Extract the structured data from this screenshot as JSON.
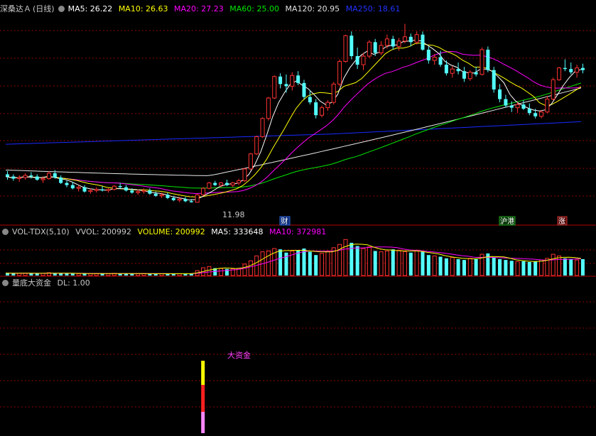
{
  "main_header": {
    "stock_name": "深桑达Ａ",
    "period": "(日线)",
    "ma5": "MA5: 26.22",
    "ma10": "MA10: 26.63",
    "ma20": "MA20: 27.23",
    "ma60": "MA60: 25.00",
    "ma120": "MA120: 20.95",
    "ma250": "MA250: 18.61"
  },
  "vol_header": {
    "name": "VOL-TDX(5,10)",
    "vvol": "VVOL: 200992",
    "volume": "VOLUME: 200992",
    "ma5": "MA5: 333648",
    "ma10": "MA10: 372981"
  },
  "ind_header": {
    "name": "量底大资金",
    "dl": "DL: 1.00"
  },
  "annotations": {
    "low_price": "11.98",
    "badge_cai": "财",
    "badge_hugang": "沪港",
    "badge_zhang": "涨",
    "signal_label": "大资金"
  },
  "colors": {
    "up": "#ff3232",
    "down": "#54ffff",
    "ma5": "#ffffff",
    "ma10": "#ffff00",
    "ma20": "#ff00ff",
    "ma60": "#00e600",
    "ma120": "#e8e8e8",
    "ma250": "#1a2aff",
    "grid": "#8a0000"
  },
  "chart_data": [
    {
      "type": "candlestick",
      "title": "深桑达Ａ (日线)",
      "series": [
        {
          "name": "MA5",
          "last": 26.22
        },
        {
          "name": "MA10",
          "last": 26.63
        },
        {
          "name": "MA20",
          "last": 27.23
        },
        {
          "name": "MA60",
          "last": 25.0
        },
        {
          "name": "MA120",
          "last": 20.95
        },
        {
          "name": "MA250",
          "last": 18.61
        }
      ],
      "low_label": 11.98,
      "ohlc": [
        [
          14.6,
          14.9,
          14.1,
          14.4
        ],
        [
          14.4,
          14.6,
          14.0,
          14.2
        ],
        [
          14.2,
          14.5,
          13.9,
          14.3
        ],
        [
          14.3,
          14.7,
          14.1,
          14.5
        ],
        [
          14.5,
          14.8,
          14.2,
          14.4
        ],
        [
          14.4,
          14.6,
          14.0,
          14.1
        ],
        [
          14.1,
          14.4,
          13.8,
          14.2
        ],
        [
          14.2,
          14.9,
          14.1,
          14.7
        ],
        [
          14.7,
          15.0,
          14.2,
          14.3
        ],
        [
          14.3,
          14.5,
          13.7,
          13.8
        ],
        [
          13.8,
          14.0,
          13.4,
          13.6
        ],
        [
          13.6,
          13.9,
          13.2,
          13.3
        ],
        [
          13.3,
          13.6,
          13.0,
          13.4
        ],
        [
          13.4,
          13.6,
          12.9,
          13.0
        ],
        [
          13.0,
          13.3,
          12.8,
          13.1
        ],
        [
          13.1,
          13.4,
          12.9,
          13.2
        ],
        [
          13.2,
          13.5,
          13.0,
          13.1
        ],
        [
          13.1,
          13.3,
          12.9,
          13.2
        ],
        [
          13.2,
          13.6,
          13.1,
          13.5
        ],
        [
          13.5,
          13.8,
          13.3,
          13.4
        ],
        [
          13.4,
          13.6,
          13.0,
          13.1
        ],
        [
          13.1,
          13.3,
          12.8,
          12.9
        ],
        [
          12.9,
          13.2,
          12.7,
          13.0
        ],
        [
          13.0,
          13.3,
          12.8,
          13.1
        ],
        [
          13.1,
          13.3,
          12.7,
          12.8
        ],
        [
          12.8,
          13.0,
          12.5,
          12.6
        ],
        [
          12.6,
          12.9,
          12.4,
          12.7
        ],
        [
          12.7,
          12.9,
          12.3,
          12.4
        ],
        [
          12.4,
          12.6,
          12.1,
          12.2
        ],
        [
          12.2,
          12.5,
          12.0,
          12.3
        ],
        [
          12.3,
          12.5,
          12.0,
          12.1
        ],
        [
          12.1,
          12.3,
          11.98,
          12.0
        ],
        [
          12.0,
          12.8,
          12.0,
          12.7
        ],
        [
          12.7,
          13.4,
          12.6,
          13.3
        ],
        [
          13.3,
          13.9,
          13.2,
          13.8
        ],
        [
          13.8,
          14.0,
          13.5,
          13.6
        ],
        [
          13.6,
          13.9,
          13.4,
          13.8
        ],
        [
          13.8,
          14.1,
          13.5,
          13.6
        ],
        [
          13.6,
          13.9,
          13.4,
          13.8
        ],
        [
          13.8,
          14.2,
          13.6,
          14.0
        ],
        [
          14.0,
          15.2,
          13.9,
          15.1
        ],
        [
          15.1,
          16.6,
          15.0,
          16.5
        ],
        [
          16.5,
          18.2,
          16.4,
          18.1
        ],
        [
          18.1,
          19.9,
          18.0,
          19.8
        ],
        [
          19.8,
          21.8,
          19.6,
          21.7
        ],
        [
          21.7,
          23.8,
          21.6,
          23.7
        ],
        [
          23.7,
          24.0,
          22.6,
          23.0
        ],
        [
          23.0,
          23.9,
          22.2,
          22.8
        ],
        [
          22.8,
          24.1,
          22.4,
          23.8
        ],
        [
          23.8,
          24.2,
          22.9,
          23.1
        ],
        [
          23.1,
          23.4,
          21.6,
          21.8
        ],
        [
          21.8,
          22.4,
          21.1,
          21.3
        ],
        [
          21.3,
          21.6,
          19.8,
          20.1
        ],
        [
          20.1,
          21.0,
          19.9,
          20.8
        ],
        [
          20.8,
          21.5,
          20.5,
          21.3
        ],
        [
          21.3,
          23.2,
          21.1,
          23.0
        ],
        [
          23.0,
          25.3,
          22.8,
          25.1
        ],
        [
          25.1,
          27.6,
          25.0,
          27.5
        ],
        [
          27.5,
          27.9,
          25.3,
          25.6
        ],
        [
          25.6,
          26.4,
          24.4,
          24.8
        ],
        [
          24.8,
          25.9,
          24.3,
          25.6
        ],
        [
          25.6,
          27.1,
          25.4,
          26.9
        ],
        [
          26.9,
          27.2,
          25.6,
          25.9
        ],
        [
          25.9,
          27.0,
          25.7,
          26.6
        ],
        [
          26.6,
          27.6,
          26.3,
          27.2
        ],
        [
          27.2,
          27.5,
          26.2,
          26.5
        ],
        [
          26.5,
          27.3,
          26.1,
          27.0
        ],
        [
          27.0,
          28.6,
          26.8,
          27.4
        ],
        [
          27.4,
          27.7,
          26.5,
          26.9
        ],
        [
          26.9,
          27.9,
          26.7,
          27.6
        ],
        [
          27.6,
          27.9,
          26.1,
          26.2
        ],
        [
          26.2,
          26.5,
          24.9,
          25.2
        ],
        [
          25.2,
          25.8,
          24.8,
          25.5
        ],
        [
          25.5,
          26.1,
          24.6,
          24.8
        ],
        [
          24.8,
          25.2,
          23.8,
          24.0
        ],
        [
          24.0,
          24.7,
          23.6,
          24.4
        ],
        [
          24.4,
          25.0,
          23.9,
          24.2
        ],
        [
          24.2,
          24.6,
          23.2,
          23.5
        ],
        [
          23.5,
          24.3,
          23.3,
          24.1
        ],
        [
          24.1,
          24.6,
          23.7,
          23.9
        ],
        [
          23.9,
          26.4,
          23.8,
          26.2
        ],
        [
          26.2,
          26.5,
          24.1,
          24.3
        ],
        [
          24.3,
          24.6,
          22.2,
          22.5
        ],
        [
          22.5,
          23.0,
          21.3,
          21.6
        ],
        [
          21.6,
          22.0,
          20.8,
          21.0
        ],
        [
          21.0,
          21.4,
          20.4,
          20.8
        ],
        [
          20.8,
          21.3,
          20.3,
          21.1
        ],
        [
          21.1,
          21.5,
          20.6,
          20.7
        ],
        [
          20.7,
          21.2,
          20.1,
          20.3
        ],
        [
          20.3,
          20.7,
          19.8,
          20.0
        ],
        [
          20.0,
          20.6,
          19.8,
          20.4
        ],
        [
          20.4,
          21.9,
          20.3,
          21.6
        ],
        [
          21.6,
          23.6,
          21.5,
          23.4
        ],
        [
          23.4,
          24.6,
          23.3,
          24.5
        ],
        [
          24.5,
          25.3,
          24.2,
          24.4
        ],
        [
          24.4,
          25.0,
          23.9,
          24.1
        ],
        [
          24.1,
          24.8,
          23.6,
          24.5
        ],
        [
          24.5,
          24.9,
          24.0,
          24.3
        ]
      ],
      "volume": [
        30,
        28,
        26,
        29,
        27,
        25,
        26,
        34,
        30,
        27,
        25,
        24,
        23,
        25,
        24,
        22,
        24,
        23,
        27,
        25,
        24,
        22,
        23,
        24,
        21,
        20,
        22,
        23,
        21,
        22,
        20,
        21,
        60,
        95,
        110,
        90,
        85,
        80,
        82,
        88,
        140,
        180,
        240,
        290,
        300,
        330,
        320,
        280,
        300,
        310,
        330,
        290,
        250,
        270,
        300,
        340,
        380,
        440,
        400,
        360,
        330,
        350,
        300,
        290,
        300,
        320,
        310,
        290,
        280,
        310,
        290,
        250,
        240,
        230,
        210,
        220,
        200,
        190,
        210,
        200,
        260,
        270,
        220,
        200,
        190,
        180,
        170,
        175,
        165,
        170,
        190,
        210,
        260,
        240,
        210,
        200,
        190,
        200
      ],
      "vol_ma5_last": 333648,
      "vol_ma10_last": 372981
    },
    {
      "type": "bar",
      "title": "量底大资金",
      "dl": 1.0,
      "signal_index": 32,
      "signal_label": "大资金"
    }
  ]
}
